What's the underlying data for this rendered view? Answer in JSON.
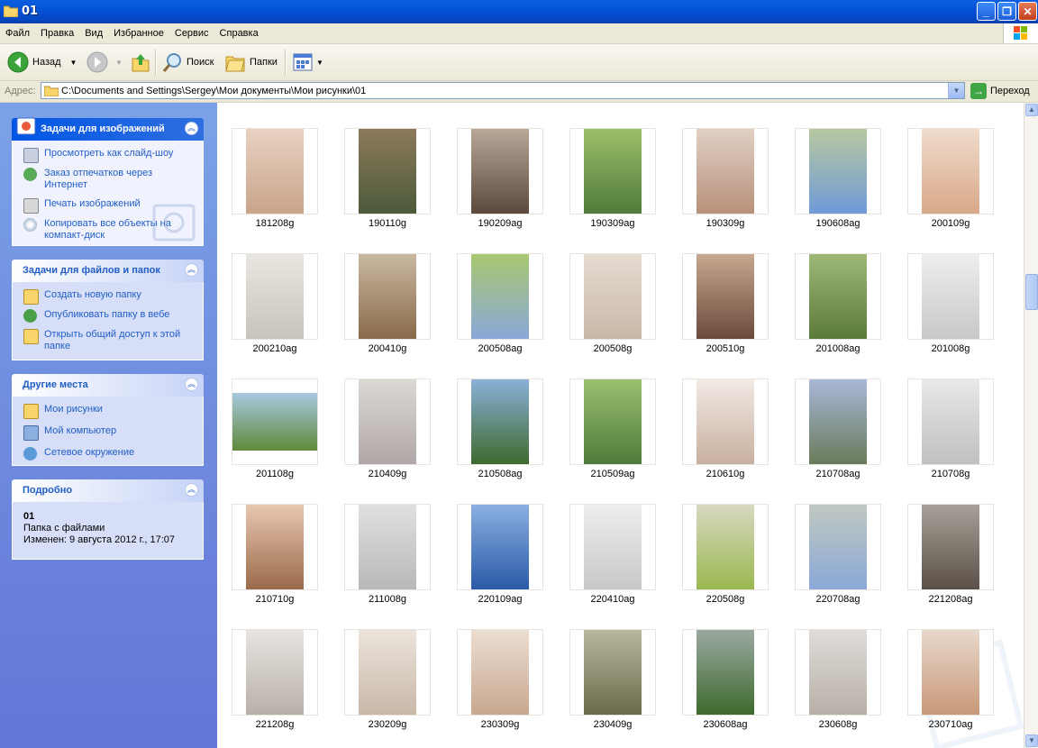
{
  "window": {
    "title": "01"
  },
  "menu": [
    "Файл",
    "Правка",
    "Вид",
    "Избранное",
    "Сервис",
    "Справка"
  ],
  "toolbar": {
    "back": "Назад",
    "search": "Поиск",
    "folders": "Папки"
  },
  "address": {
    "label": "Адрес:",
    "path": "C:\\Documents and Settings\\Sergey\\Мои документы\\Мои рисунки\\01",
    "go": "Переход"
  },
  "panels": {
    "image_tasks": {
      "title": "Задачи для изображений",
      "items": [
        "Просмотреть как слайд-шоу",
        "Заказ отпечатков через Интернет",
        "Печать изображений",
        "Копировать все объекты на компакт-диск"
      ]
    },
    "file_tasks": {
      "title": "Задачи для файлов и папок",
      "items": [
        "Создать новую папку",
        "Опубликовать папку в вебе",
        "Открыть общий доступ к этой папке"
      ]
    },
    "other_places": {
      "title": "Другие места",
      "items": [
        "Мои рисунки",
        "Мой компьютер",
        "Сетевое окружение"
      ]
    },
    "details": {
      "title": "Подробно",
      "name": "01",
      "type": "Папка с файлами",
      "modified": "Изменен: 9 августа 2012 г., 17:07"
    }
  },
  "files": [
    {
      "name": "181208g",
      "c1": "#C9A48A",
      "c2": "#E8D2C2",
      "o": "p"
    },
    {
      "name": "190110g",
      "c1": "#4C5A3A",
      "c2": "#8C7A5A",
      "o": "p"
    },
    {
      "name": "190209ag",
      "c1": "#5A4A3E",
      "c2": "#B8A898",
      "o": "p"
    },
    {
      "name": "190309ag",
      "c1": "#4F7A3A",
      "c2": "#9BBF6A",
      "o": "p"
    },
    {
      "name": "190309g",
      "c1": "#B8907A",
      "c2": "#E0D0C4",
      "o": "p"
    },
    {
      "name": "190608ag",
      "c1": "#6F9AD8",
      "c2": "#B8C8A0",
      "o": "p"
    },
    {
      "name": "200109g",
      "c1": "#D8A888",
      "c2": "#F0DCCC",
      "o": "p"
    },
    {
      "name": "200210ag",
      "c1": "#C8C4BC",
      "c2": "#E8E6E0",
      "o": "p"
    },
    {
      "name": "200410g",
      "c1": "#8A6A4A",
      "c2": "#C8B8A0",
      "o": "p"
    },
    {
      "name": "200508ag",
      "c1": "#8AA8D8",
      "c2": "#A8C870",
      "o": "p"
    },
    {
      "name": "200508g",
      "c1": "#C8B8A8",
      "c2": "#E6DCD2",
      "o": "p"
    },
    {
      "name": "200510g",
      "c1": "#6A4A3A",
      "c2": "#C8A890",
      "o": "p"
    },
    {
      "name": "201008ag",
      "c1": "#5A7A3A",
      "c2": "#9FB878",
      "o": "p"
    },
    {
      "name": "201008g",
      "c1": "#C8C8C8",
      "c2": "#EEEEEE",
      "o": "p"
    },
    {
      "name": "201108g",
      "c1": "#5E8A3A",
      "c2": "#A8C8E0",
      "o": "l"
    },
    {
      "name": "210409g",
      "c1": "#B0A8A8",
      "c2": "#DCD8D4",
      "o": "p"
    },
    {
      "name": "210508ag",
      "c1": "#3E6A2E",
      "c2": "#8AB0D8",
      "o": "p"
    },
    {
      "name": "210509ag",
      "c1": "#4E7A3A",
      "c2": "#9AC070",
      "o": "p"
    },
    {
      "name": "210610g",
      "c1": "#C8B0A0",
      "c2": "#F2EAE4",
      "o": "p"
    },
    {
      "name": "210708ag",
      "c1": "#6A7A5A",
      "c2": "#A8B8D8",
      "o": "p"
    },
    {
      "name": "210708g",
      "c1": "#C0C0C0",
      "c2": "#E8E8E8",
      "o": "p"
    },
    {
      "name": "210710g",
      "c1": "#9A6A4A",
      "c2": "#E8C8B0",
      "o": "p"
    },
    {
      "name": "211008g",
      "c1": "#B8B8B8",
      "c2": "#E0E0E0",
      "o": "p"
    },
    {
      "name": "220109ag",
      "c1": "#2A5AA8",
      "c2": "#8AB0E0",
      "o": "p"
    },
    {
      "name": "220410ag",
      "c1": "#C8C8C8",
      "c2": "#EEEEEE",
      "o": "p"
    },
    {
      "name": "220508g",
      "c1": "#9AB850",
      "c2": "#D8D8C0",
      "o": "p"
    },
    {
      "name": "220708ag",
      "c1": "#8AA8D8",
      "c2": "#C0C8C0",
      "o": "p"
    },
    {
      "name": "221208ag",
      "c1": "#5A5048",
      "c2": "#A8A098",
      "o": "p"
    },
    {
      "name": "221208g",
      "c1": "#B8B0A8",
      "c2": "#E8E4E0",
      "o": "p"
    },
    {
      "name": "230209g",
      "c1": "#C8B8A8",
      "c2": "#ECE4DC",
      "o": "p"
    },
    {
      "name": "230309g",
      "c1": "#C8A890",
      "c2": "#ECDED2",
      "o": "p"
    },
    {
      "name": "230409g",
      "c1": "#6A6A4A",
      "c2": "#B8B8A0",
      "o": "p"
    },
    {
      "name": "230608ag",
      "c1": "#3E6A2E",
      "c2": "#9AA8A0",
      "o": "p"
    },
    {
      "name": "230608g",
      "c1": "#B8B0A8",
      "c2": "#E0DCD8",
      "o": "p"
    },
    {
      "name": "230710ag",
      "c1": "#C89878",
      "c2": "#E8D8CC",
      "o": "p"
    }
  ]
}
